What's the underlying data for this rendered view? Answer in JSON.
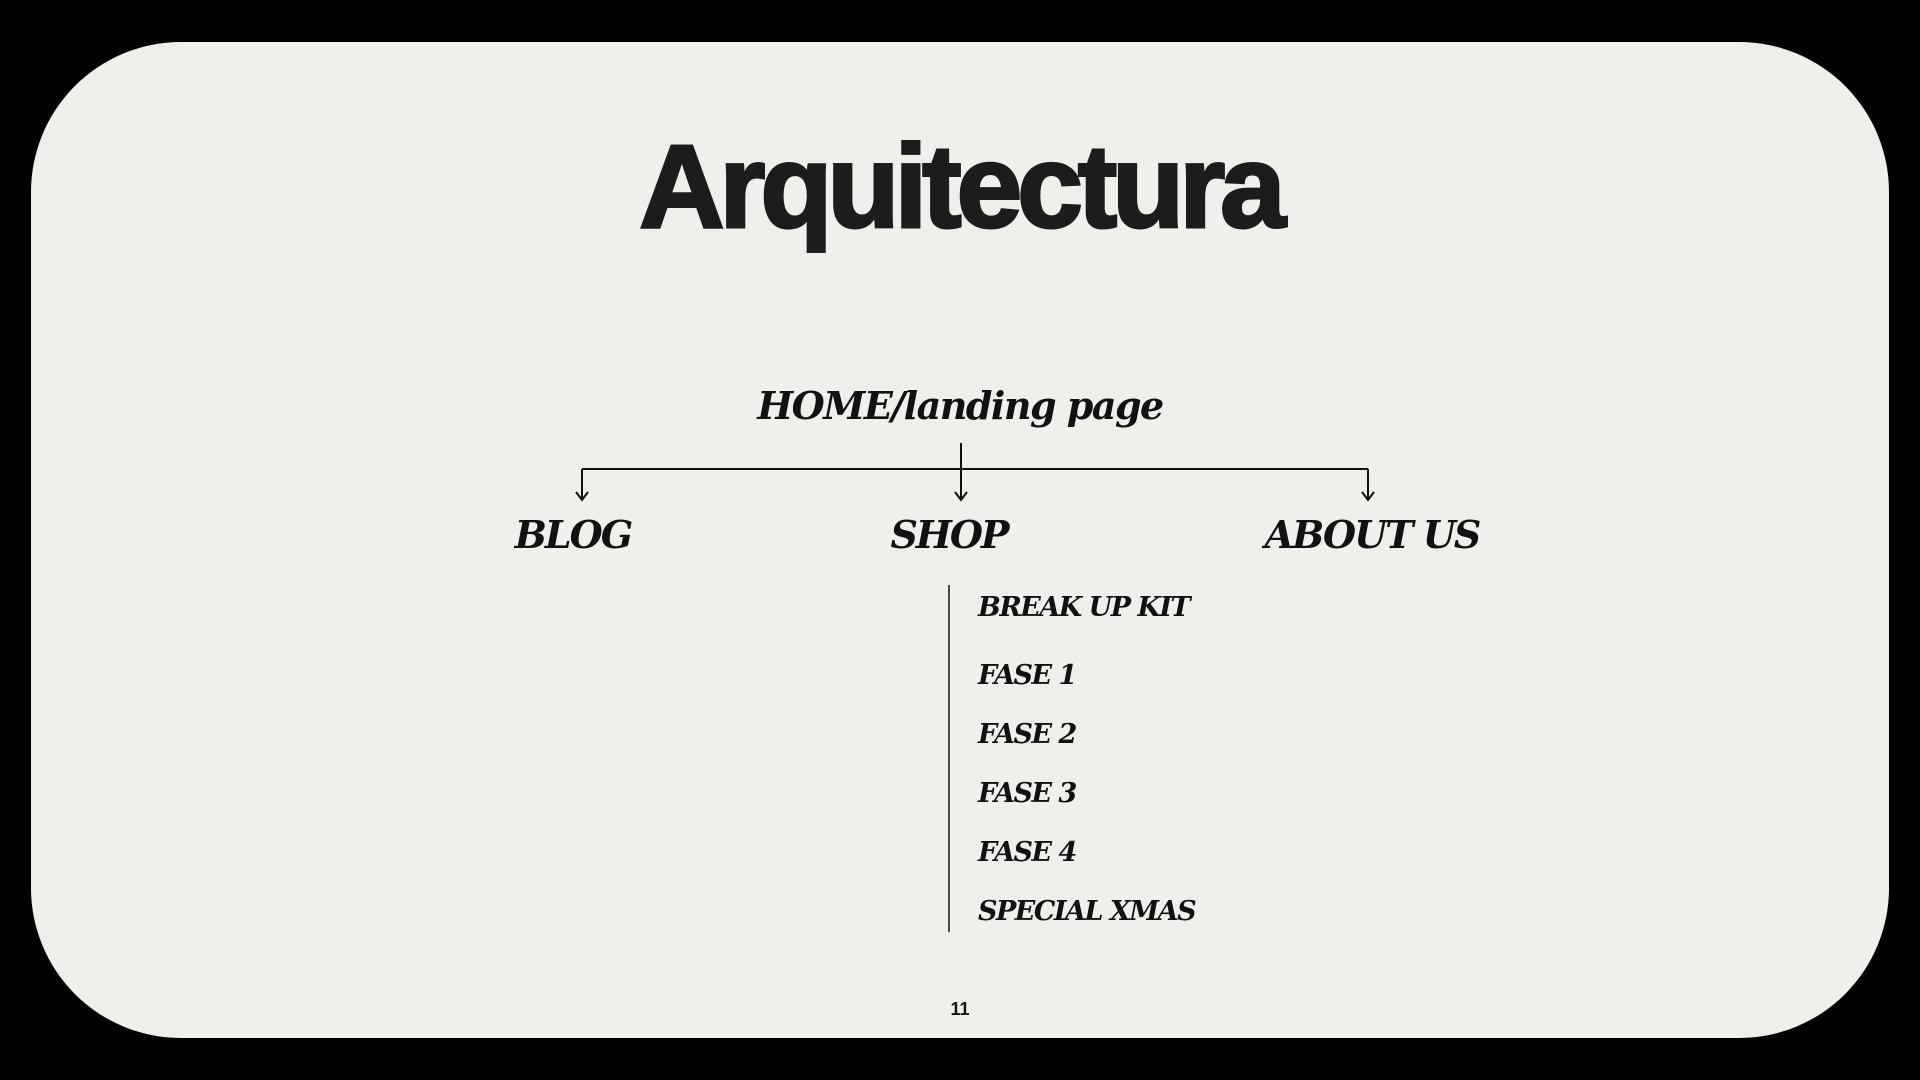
{
  "slide": {
    "title": "Arquitectura",
    "page_number": "11"
  },
  "diagram": {
    "root": "HOME/landing page",
    "children": [
      {
        "label": "BLOG"
      },
      {
        "label": "SHOP"
      },
      {
        "label": "ABOUT US"
      }
    ],
    "shop_items": [
      "BREAK UP KIT",
      "FASE 1",
      "FASE 2",
      "FASE 3",
      "FASE 4",
      "SPECIAL XMAS"
    ]
  },
  "colors": {
    "frame": "#000000",
    "card": "#f0efec",
    "text": "#111111"
  }
}
